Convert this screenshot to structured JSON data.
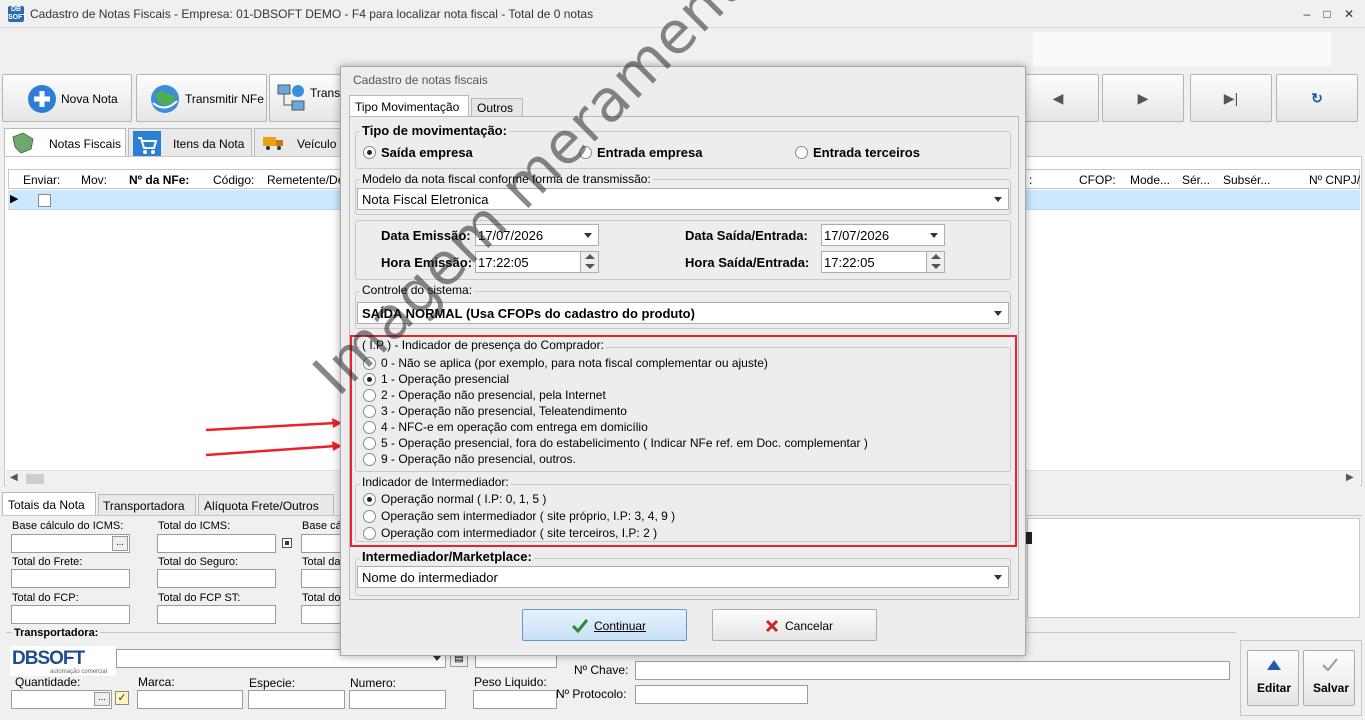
{
  "window": {
    "title": "Cadastro de Notas Fiscais - Empresa: 01-DBSOFT DEMO - F4 para localizar nota fiscal - Total de 0 notas",
    "app_icon": "DB SOFT"
  },
  "toolbar": {
    "nova_nota": "Nova Nota",
    "transmitir_nfe": "Transmitir NFe",
    "transmitir_partial": "Trans"
  },
  "tabs_main": [
    "Notas Fiscais",
    "Itens da Nota",
    "Veículo"
  ],
  "grid": {
    "columns_left": [
      "Enviar:",
      "Mov:",
      "Nº da NFe:",
      "Código:",
      "Remetente/De"
    ],
    "columns_right": [
      ":",
      "CFOP:",
      "Mode...",
      "Sér...",
      "Subsér...",
      "Nº CNPJ/"
    ]
  },
  "bottom_tabs": [
    "Totais da Nota",
    "Transportadora",
    "Alíquota Frete/Outros"
  ],
  "totals": {
    "base_icms": "Base cálculo do ICMS:",
    "total_icms": "Total do ICMS:",
    "base_partial": "Base cálc",
    "total_frete": "Total do Frete:",
    "total_seguro": "Total do Seguro:",
    "total_partial_1": "Total da",
    "total_fcp": "Total do FCP:",
    "total_fcp_st": "Total do FCP ST:",
    "total_partial_2": "Total do"
  },
  "transport": {
    "title": "Transportadora:",
    "quantidade": "Quantidade:",
    "marca": "Marca:",
    "especie": "Especie:",
    "numero": "Numero:",
    "peso": "Peso Liquido:",
    "chave": "Nº Chave:",
    "protocolo": "Nº Protocolo:",
    "logo": "DBSOFT",
    "logo_sub": "automação comercial"
  },
  "right_buttons": {
    "editar": "Editar",
    "salvar": "Salvar"
  },
  "dialog": {
    "title": "Cadastro de notas fiscais",
    "tabs": [
      "Tipo Movimentação",
      "Outros"
    ],
    "tipo_mov": {
      "title": "Tipo de movimentação:",
      "options": [
        "Saída empresa",
        "Entrada empresa",
        "Entrada terceiros"
      ],
      "selected": 0
    },
    "modelo": {
      "title": "Modelo da nota fiscal conforme forma de transmissão:",
      "value": "Nota Fiscal Eletronica"
    },
    "datas": {
      "data_emissao_label": "Data Emissão:",
      "data_emissao": "17/07/2026",
      "hora_emissao_label": "Hora Emissão:",
      "hora_emissao": "17:22:05",
      "data_saida_label": "Data Saída/Entrada:",
      "data_saida": "17/07/2026",
      "hora_saida_label": "Hora Saída/Entrada:",
      "hora_saida": "17:22:05"
    },
    "controle": {
      "title": "Controle do sistema:",
      "value": "SAÍDA NORMAL (Usa CFOPs do cadastro do produto)"
    },
    "presenca": {
      "title": "( I.P ) - Indicador de presença do Comprador:",
      "options": [
        "0 - Não se aplica (por exemplo, para nota fiscal complementar ou ajuste)",
        "1 - Operação presencial",
        "2 - Operação não presencial, pela Internet",
        "3 - Operação não presencial, Teleatendimento",
        "4 - NFC-e em operação com entrega em domicílio",
        "5 - Operação presencial, fora do estabelicimento ( Indicar NFe ref. em Doc. complementar )",
        "9 - Operação não presencial, outros."
      ],
      "selected": 1
    },
    "intermediador": {
      "title": "Indicador de Intermediador:",
      "options": [
        "Operação normal ( I.P: 0, 1, 5 )",
        "Operação sem intermediador ( site próprio, I.P: 3, 4, 9 )",
        "Operação com intermediador ( site terceiros, I.P: 2 )"
      ],
      "selected": 0
    },
    "marketplace": {
      "title": "Intermediador/Marketplace:",
      "value": "Nome do intermediador"
    },
    "buttons": {
      "continuar": "Continuar",
      "cancelar": "Cancelar"
    }
  },
  "watermark": "Imagem meramente ilustrativa",
  "colors": {
    "highlight_border": "#e8232a",
    "selected_row": "#cce8ff",
    "arrow": "#e8232a"
  }
}
